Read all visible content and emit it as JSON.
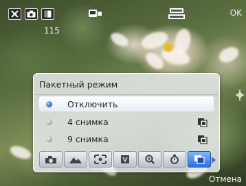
{
  "status_bar": {
    "icons": [
      "close-icon",
      "camera-icon",
      "brightness-icon",
      "camera-mode-icon",
      "resolution-icon"
    ],
    "shot_count": "115",
    "ok_label": "OK"
  },
  "menu": {
    "title": "Пакетный режим",
    "options": [
      {
        "label": "Отключить",
        "selected": true,
        "icon": ""
      },
      {
        "label": "4 снимка",
        "selected": false,
        "icon": "burst-icon"
      },
      {
        "label": "9 снимка",
        "selected": false,
        "icon": "burst-icon"
      }
    ]
  },
  "toolbar": {
    "buttons": [
      {
        "name": "scene-mode-icon",
        "active": false
      },
      {
        "name": "landscape-icon",
        "active": false
      },
      {
        "name": "focus-frame-icon",
        "active": false
      },
      {
        "name": "white-balance-icon",
        "active": false
      },
      {
        "name": "zoom-icon",
        "active": false
      },
      {
        "name": "timer-icon",
        "active": false
      },
      {
        "name": "burst-mode-icon",
        "active": true
      }
    ]
  },
  "bottom": {
    "cancel_label": "Отмена"
  },
  "colors": {
    "accent": "#2f6fe0",
    "panel": "#ebeef2"
  }
}
